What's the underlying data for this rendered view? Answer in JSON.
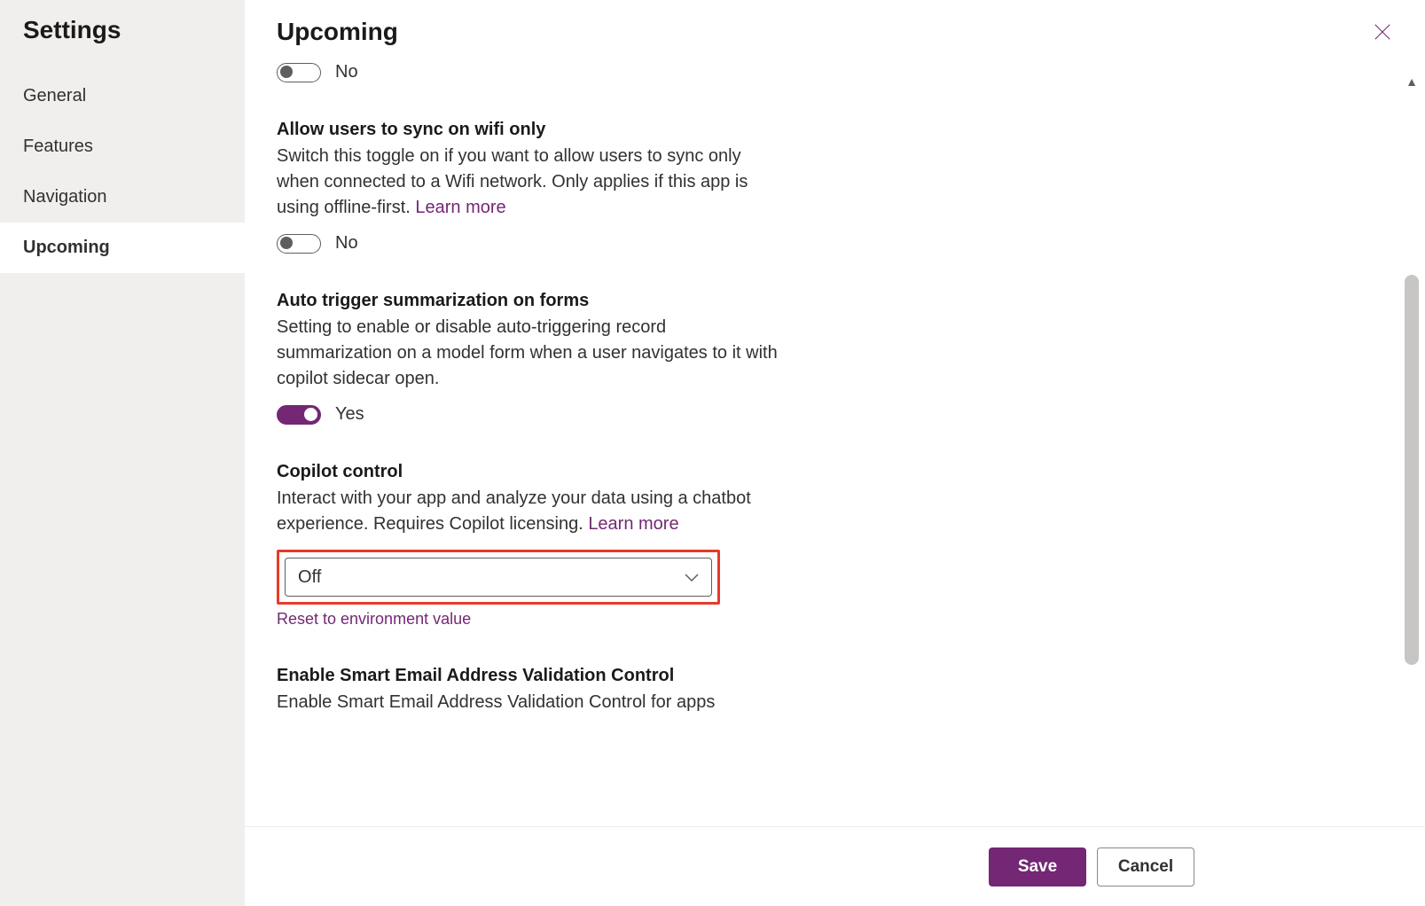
{
  "sidebar": {
    "title": "Settings",
    "items": [
      {
        "label": "General"
      },
      {
        "label": "Features"
      },
      {
        "label": "Navigation"
      },
      {
        "label": "Upcoming",
        "active": true
      }
    ]
  },
  "main": {
    "title": "Upcoming"
  },
  "settings": {
    "s0": {
      "toggle_state": "No"
    },
    "s1": {
      "title": "Allow users to sync on wifi only",
      "desc_a": "Switch this toggle on if you want to allow users to sync only when connected to a Wifi network. Only applies if this app is using offline-first. ",
      "learn_more": "Learn more",
      "toggle_state": "No"
    },
    "s2": {
      "title": "Auto trigger summarization on forms",
      "desc": "Setting to enable or disable auto-triggering record summarization on a model form when a user navigates to it with copilot sidecar open.",
      "toggle_state": "Yes"
    },
    "s3": {
      "title": "Copilot control",
      "desc_a": "Interact with your app and analyze your data using a chatbot experience. Requires Copilot licensing. ",
      "learn_more": "Learn more",
      "select_value": "Off",
      "reset": "Reset to environment value"
    },
    "s4": {
      "title": "Enable Smart Email Address Validation Control",
      "desc": "Enable Smart Email Address Validation Control for apps"
    }
  },
  "footer": {
    "save": "Save",
    "cancel": "Cancel"
  }
}
